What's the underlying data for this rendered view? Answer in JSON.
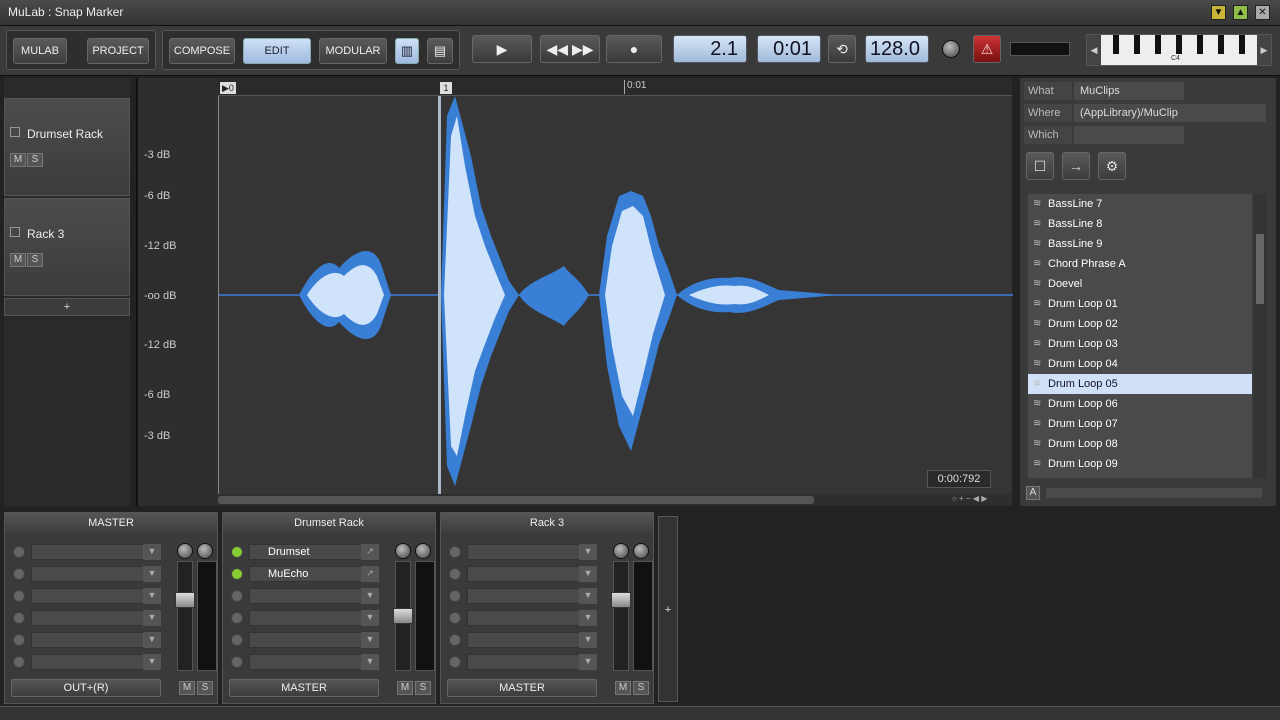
{
  "window": {
    "title": "MuLab : Snap Marker",
    "controls": [
      "▼",
      "▲",
      "✕"
    ]
  },
  "toolbar": {
    "mulab": "MULAB",
    "project": "PROJECT",
    "compose": "COMPOSE",
    "edit": "EDIT",
    "modular": "MODULAR",
    "position": "2.1",
    "time": "0:01",
    "tempo": "128.0",
    "keyboard_label": "C4"
  },
  "tracks": [
    {
      "name": "Drumset Rack",
      "m": "M",
      "s": "S"
    },
    {
      "name": "Rack 3",
      "m": "M",
      "s": "S"
    }
  ],
  "add_track": "+",
  "editor": {
    "db_labels": [
      "-3 dB",
      "-6 dB",
      "-12 dB",
      "-oo dB",
      "-12 dB",
      "-6 dB",
      "-3 dB"
    ],
    "ruler": [
      "0",
      "1",
      "0:01"
    ],
    "time_readout": "0:00:792"
  },
  "browser": {
    "what_label": "What",
    "what_value": "MuClips",
    "where_label": "Where",
    "where_value": "(AppLibrary)/MuClip",
    "which_label": "Which",
    "which_value": "",
    "items": [
      "BassLine 7",
      "BassLine 8",
      "BassLine 9",
      "Chord Phrase A",
      "Doevel",
      "Drum Loop 01",
      "Drum Loop 02",
      "Drum Loop 03",
      "Drum Loop 04",
      "Drum Loop 05",
      "Drum Loop 06",
      "Drum Loop 07",
      "Drum Loop 08",
      "Drum Loop 09"
    ],
    "selected": "Drum Loop 05",
    "a_button": "A"
  },
  "mixer": [
    {
      "name": "MASTER",
      "slots": [
        "",
        "",
        "",
        "",
        "",
        ""
      ],
      "output": "OUT+(R)"
    },
    {
      "name": "Drumset Rack",
      "slots": [
        "Drumset",
        "MuEcho",
        "",
        "",
        "",
        ""
      ],
      "output": "MASTER"
    },
    {
      "name": "Rack 3",
      "slots": [
        "",
        "",
        "",
        "",
        "",
        ""
      ],
      "output": "MASTER"
    }
  ],
  "mixer_add": "+",
  "colors": {
    "accent": "#cfe0f7",
    "waveform": "#3a7fd6",
    "waveform_light": "#cfe3fb"
  }
}
